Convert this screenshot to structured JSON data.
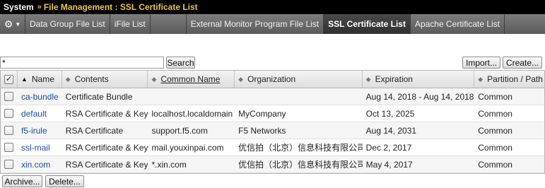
{
  "titlebar": {
    "section": "System",
    "separator": "»",
    "path": "File Management : SSL Certificate List"
  },
  "tabs": [
    {
      "label": "Data Group File List"
    },
    {
      "label": "iFile List"
    },
    {
      "label": "External Monitor Program File List"
    },
    {
      "label": "SSL Certificate List",
      "active": true
    },
    {
      "label": "Apache Certificate List"
    }
  ],
  "search": {
    "value": "*",
    "button": "Search"
  },
  "actions": {
    "import": "Import...",
    "create": "Create..."
  },
  "table": {
    "headers": {
      "name": "Name",
      "contents": "Contents",
      "common_name": "Common Name",
      "organization": "Organization",
      "expiration": "Expiration",
      "partition": "Partition / Path"
    },
    "rows": [
      {
        "name": "ca-bundle",
        "contents": "Certificate Bundle",
        "common_name": "",
        "organization": "",
        "expiration": "Aug 14, 2018 - Aug 14, 2018",
        "partition": "Common"
      },
      {
        "name": "default",
        "contents": "RSA Certificate & Key",
        "common_name": "localhost.localdomain",
        "organization": "MyCompany",
        "expiration": "Oct 13, 2025",
        "partition": "Common"
      },
      {
        "name": "f5-irule",
        "contents": "RSA Certificate",
        "common_name": "support.f5.com",
        "organization": "F5 Networks",
        "expiration": "Aug 14, 2031",
        "partition": "Common"
      },
      {
        "name": "ssl-mail",
        "contents": "RSA Certificate & Key",
        "common_name": "mail.youxinpai.com",
        "organization": "优信拍（北京）信息科技有限公司",
        "expiration": "Dec 2, 2017",
        "partition": "Common"
      },
      {
        "name": "xin.com",
        "contents": "RSA Certificate & Key",
        "common_name": "*.xin.com",
        "organization": "优信拍（北京）信息科技有限公司",
        "expiration": "May 4, 2017",
        "partition": "Common"
      }
    ]
  },
  "footer": {
    "archive": "Archive...",
    "delete": "Delete..."
  },
  "colors": {
    "titlebar_bg": "#000000",
    "path_text": "#f0c44a",
    "link": "#1a4fa3",
    "tabbar_bg": "#6b6b6b"
  },
  "icons": {
    "settings": "gear-icon",
    "sort_active": "sort-up-icon",
    "sort_inactive": "sort-both-icon"
  }
}
